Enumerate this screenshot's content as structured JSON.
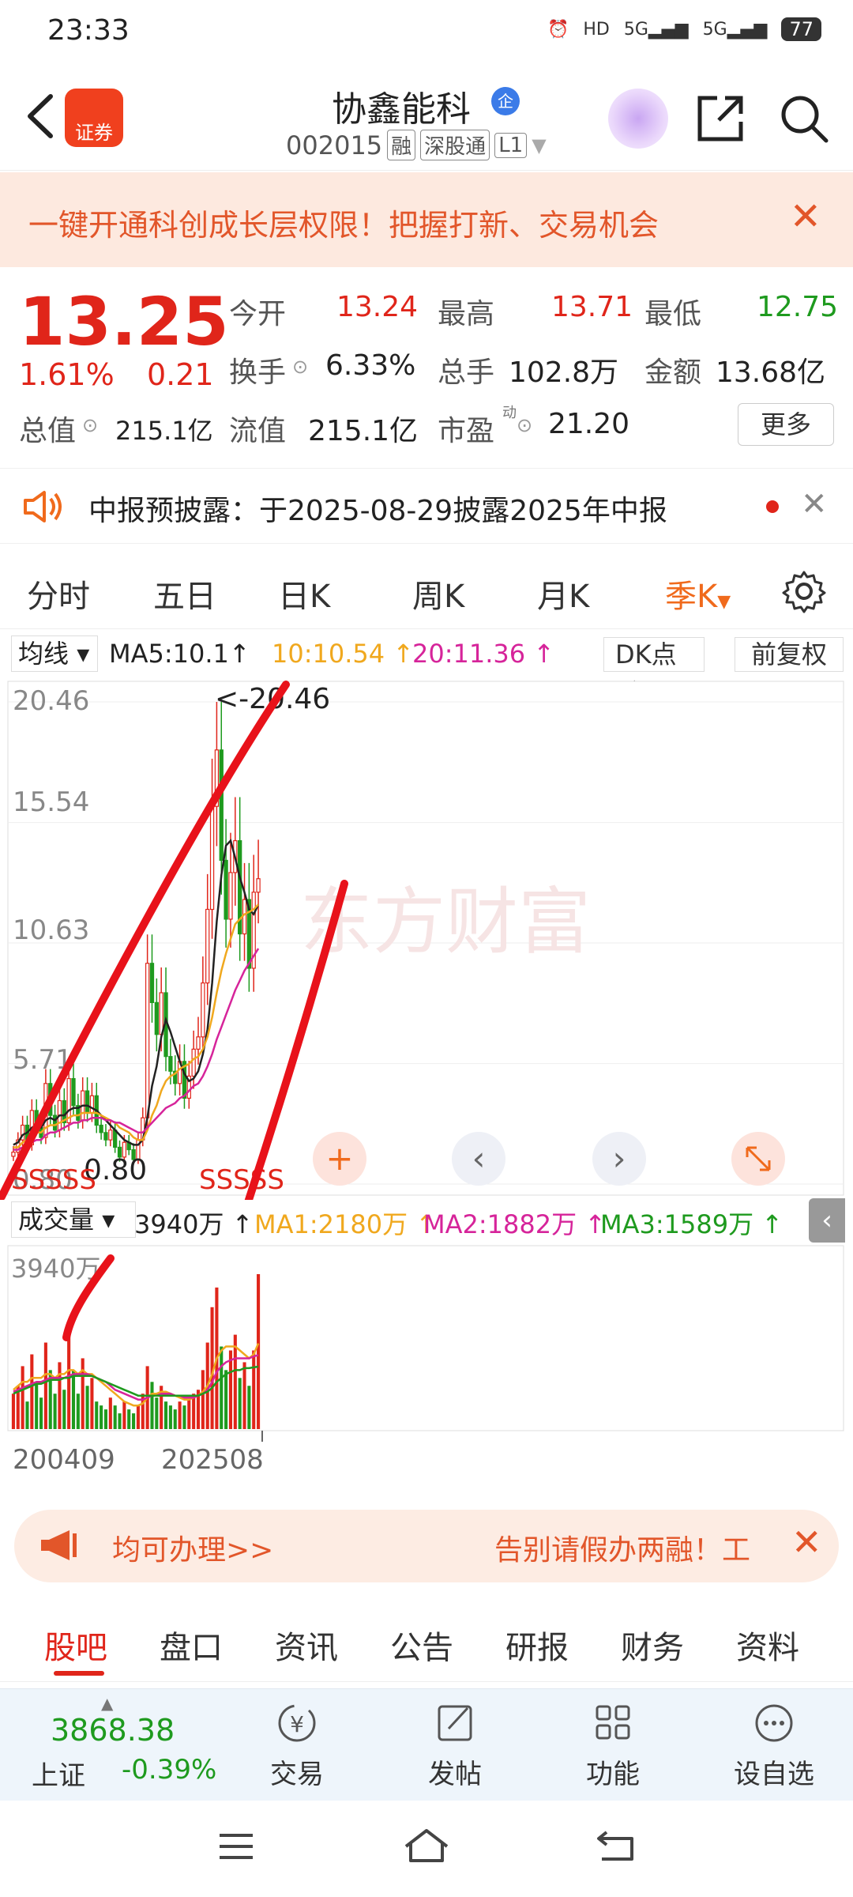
{
  "status": {
    "time": "23:33",
    "hd": "HD",
    "net1": "5G",
    "net2": "5G",
    "battery": "77"
  },
  "header": {
    "broker_label": "证券",
    "stock_name": "协鑫能科",
    "badge": "企",
    "code": "002015",
    "tags": [
      "融",
      "深股通",
      "L1"
    ]
  },
  "promo": {
    "text": "一键开通科创成长层权限！把握打新、交易机会",
    "close": "✕"
  },
  "quote": {
    "price": "13.25",
    "change_pct": "1.61%",
    "change_amt": "0.21",
    "fields": {
      "open_label": "今开",
      "open": "13.24",
      "high_label": "最高",
      "high": "13.71",
      "low_label": "最低",
      "low": "12.75",
      "turnover_label": "换手",
      "turnover": "6.33%",
      "volume_label": "总手",
      "volume": "102.8万",
      "amount_label": "金额",
      "amount": "13.68亿",
      "mktcap_label": "总值",
      "mktcap": "215.1亿",
      "float_label": "流值",
      "float": "215.1亿",
      "pe_label": "市盈",
      "pe_sup": "动",
      "pe": "21.20"
    },
    "more": "更多"
  },
  "notice": {
    "text": "中报预披露：于2025-08-29披露2025年中报",
    "close": "✕"
  },
  "period_tabs": [
    "分时",
    "五日",
    "日K",
    "周K",
    "月K",
    "季K"
  ],
  "active_period": "季K",
  "ma_bar": {
    "selector": "均线",
    "ma5": "MA5:10.1",
    "ma10": "10:10.54 ↑",
    "ma20": "20:11.36 ↑",
    "dk": "DK点",
    "fq": "前复权",
    "colors": {
      "ma5": "#222222",
      "ma10": "#f0a81e",
      "ma20": "#d6249a"
    }
  },
  "kchart": {
    "y_ticks": [
      "20.46",
      "15.54",
      "10.63",
      "5.71",
      "0.80"
    ],
    "max_annotation": "<-20.46",
    "low_annotation": "0.80",
    "marks": "SSSSS",
    "watermark": "东方财富",
    "buttons": [
      "+",
      "‹",
      "›"
    ]
  },
  "volume_bar": {
    "selector": "成交量",
    "current": "3940万 ↑",
    "ma1": "MA1:2180万 ↑",
    "ma2": "MA2:1882万 ↑",
    "ma3": "MA3:1589万 ↑",
    "colors": {
      "ma1": "#f0a81e",
      "ma2": "#d6249a",
      "ma3": "#1e9a1e"
    },
    "y_max": "3940万",
    "x_labels": [
      "200409",
      "202508"
    ]
  },
  "chart_data": {
    "type": "candlestick",
    "title": "",
    "y_axis": {
      "min": 0.8,
      "max": 20.46,
      "ticks": [
        20.46,
        15.54,
        10.63,
        5.71,
        0.8
      ]
    },
    "x_axis": {
      "labels": [
        "200409",
        "202508"
      ]
    },
    "close": [
      2.1,
      2.6,
      3.2,
      2.4,
      3.8,
      3.1,
      2.7,
      4.9,
      3.6,
      3.0,
      4.2,
      3.3,
      5.1,
      4.0,
      3.4,
      4.6,
      3.7,
      4.4,
      3.2,
      2.9,
      2.6,
      3.0,
      2.3,
      1.9,
      2.5,
      2.2,
      1.8,
      2.6,
      3.5,
      9.8,
      8.2,
      6.9,
      8.6,
      6.0,
      5.4,
      4.9,
      5.8,
      4.3,
      5.2,
      6.3,
      6.8,
      9.0,
      12.0,
      16.2,
      18.5,
      14.0,
      11.6,
      13.5,
      14.8,
      11.0,
      12.4,
      9.6,
      12.7,
      13.25
    ],
    "ma_series": [
      {
        "name": "MA5",
        "values": [
          2.4,
          2.5,
          2.8,
          2.9,
          3.1,
          3.2,
          3.1,
          3.4,
          3.5,
          3.4,
          3.6,
          3.6,
          3.8,
          3.9,
          3.9,
          4.0,
          4.0,
          3.9,
          3.8,
          3.6,
          3.4,
          3.2,
          3.0,
          2.8,
          2.6,
          2.5,
          2.4,
          2.4,
          2.6,
          3.5,
          4.8,
          5.6,
          6.8,
          7.5,
          7.0,
          6.4,
          5.8,
          5.3,
          5.0,
          5.1,
          5.4,
          6.1,
          7.1,
          9.0,
          11.5,
          13.4,
          14.6,
          14.8,
          14.1,
          13.3,
          12.7,
          12.0,
          11.8,
          12.2
        ]
      },
      {
        "name": "MA10",
        "values": [
          2.3,
          2.3,
          2.5,
          2.6,
          2.8,
          2.9,
          2.9,
          3.1,
          3.2,
          3.2,
          3.3,
          3.4,
          3.5,
          3.6,
          3.6,
          3.7,
          3.7,
          3.7,
          3.7,
          3.6,
          3.5,
          3.4,
          3.3,
          3.1,
          3.0,
          2.9,
          2.7,
          2.6,
          2.6,
          3.0,
          3.6,
          4.0,
          4.6,
          5.0,
          5.2,
          5.3,
          5.5,
          5.6,
          5.7,
          5.9,
          6.0,
          6.3,
          6.8,
          7.6,
          8.6,
          9.5,
          10.2,
          10.8,
          11.4,
          11.6,
          11.8,
          11.9,
          12.0,
          12.2
        ]
      },
      {
        "name": "MA20",
        "values": [
          2.2,
          2.2,
          2.3,
          2.4,
          2.5,
          2.6,
          2.6,
          2.8,
          2.9,
          2.9,
          3.0,
          3.1,
          3.2,
          3.3,
          3.3,
          3.4,
          3.4,
          3.5,
          3.5,
          3.5,
          3.4,
          3.4,
          3.3,
          3.3,
          3.2,
          3.1,
          3.0,
          2.9,
          2.9,
          3.1,
          3.3,
          3.5,
          3.7,
          3.9,
          4.0,
          4.1,
          4.3,
          4.4,
          4.6,
          4.8,
          4.9,
          5.2,
          5.6,
          6.1,
          6.7,
          7.2,
          7.7,
          8.2,
          8.7,
          9.1,
          9.5,
          9.8,
          10.1,
          10.4
        ]
      }
    ],
    "volume": [
      900,
      1100,
      1600,
      700,
      1900,
      1200,
      800,
      2200,
      1500,
      900,
      1700,
      1000,
      2600,
      1500,
      900,
      1800,
      1100,
      1300,
      700,
      600,
      500,
      800,
      600,
      400,
      700,
      500,
      400,
      600,
      900,
      1600,
      1200,
      800,
      1100,
      700,
      600,
      500,
      700,
      600,
      800,
      900,
      1000,
      1500,
      2200,
      3100,
      3600,
      2100,
      1500,
      2000,
      2400,
      1300,
      1700,
      1100,
      2000,
      3940
    ],
    "volume_ma": [
      {
        "name": "MA1",
        "values": [
          1000,
          1100,
          1200,
          1200,
          1300,
          1300,
          1300,
          1400,
          1400,
          1300,
          1400,
          1400,
          1500,
          1500,
          1400,
          1500,
          1400,
          1400,
          1300,
          1200,
          1100,
          1000,
          900,
          800,
          700,
          650,
          600,
          600,
          650,
          800,
          900,
          900,
          950,
          950,
          900,
          850,
          800,
          750,
          750,
          800,
          850,
          950,
          1100,
          1400,
          1800,
          2000,
          2100,
          2100,
          2100,
          2000,
          1900,
          1800,
          1900,
          2180
        ]
      },
      {
        "name": "MA2",
        "values": [
          950,
          1000,
          1050,
          1100,
          1150,
          1200,
          1200,
          1250,
          1300,
          1300,
          1300,
          1300,
          1350,
          1400,
          1400,
          1400,
          1400,
          1350,
          1300,
          1250,
          1200,
          1100,
          1000,
          950,
          900,
          850,
          800,
          750,
          750,
          800,
          850,
          850,
          900,
          900,
          900,
          850,
          850,
          800,
          800,
          800,
          850,
          900,
          1000,
          1200,
          1450,
          1600,
          1700,
          1750,
          1800,
          1800,
          1800,
          1800,
          1850,
          1882
        ]
      },
      {
        "name": "MA3",
        "values": [
          900,
          950,
          1000,
          1050,
          1100,
          1150,
          1150,
          1200,
          1250,
          1250,
          1250,
          1300,
          1300,
          1350,
          1350,
          1350,
          1350,
          1350,
          1300,
          1250,
          1200,
          1150,
          1100,
          1050,
          1000,
          950,
          900,
          850,
          850,
          850,
          850,
          850,
          850,
          850,
          850,
          850,
          850,
          850,
          850,
          850,
          850,
          900,
          950,
          1050,
          1200,
          1300,
          1400,
          1450,
          1500,
          1500,
          1550,
          1550,
          1570,
          1589
        ]
      }
    ]
  },
  "pill": {
    "left_text": "均可办理>>",
    "right_text": "告别请假办两融！工",
    "close": "✕"
  },
  "content_tabs": [
    "股吧",
    "盘口",
    "资讯",
    "公告",
    "研报",
    "财务",
    "资料"
  ],
  "bottom": {
    "index_value": "3868.38",
    "index_name": "上证",
    "index_change": "-0.39%",
    "items": [
      "交易",
      "发帖",
      "功能",
      "设自选"
    ]
  }
}
